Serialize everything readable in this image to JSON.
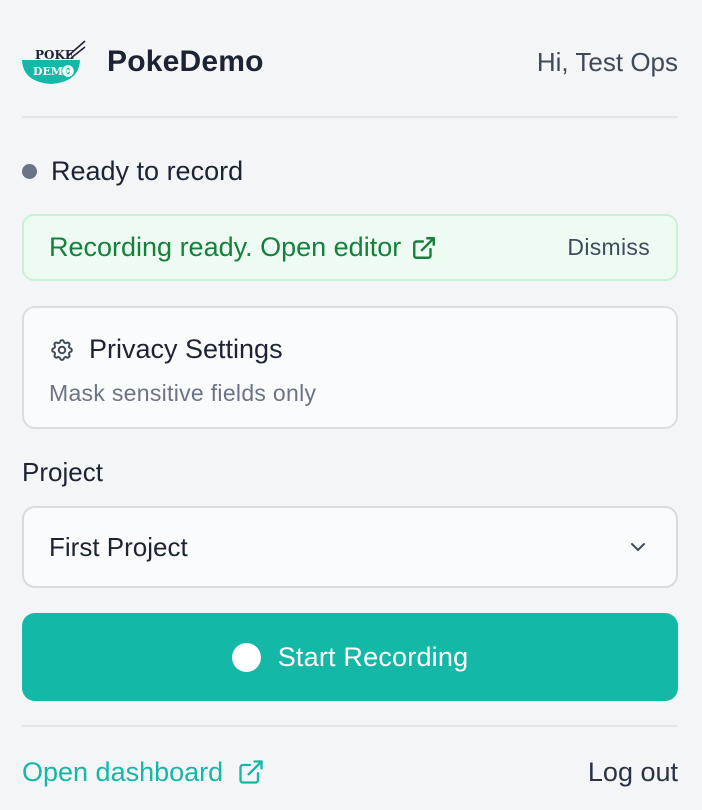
{
  "app": {
    "logo_text_top": "POKE",
    "logo_text_bottom": "DEMO",
    "brand": "PokeDemo",
    "greeting": "Hi, Test Ops"
  },
  "status": {
    "text": "Ready to record",
    "dot_color": "#6b7486"
  },
  "alert": {
    "message": "Recording ready. Open editor",
    "link_icon": "external-link-icon",
    "dismiss_label": "Dismiss",
    "text_color": "#15803d",
    "background": "#eefbf3"
  },
  "privacy": {
    "icon": "gear-icon",
    "title": "Privacy Settings",
    "subtitle": "Mask sensitive fields only"
  },
  "project": {
    "label": "Project",
    "selected": "First Project",
    "chevron_icon": "chevron-down-icon"
  },
  "record_button": {
    "label": "Start Recording",
    "color": "#14b8a6"
  },
  "footer": {
    "dashboard_link": "Open dashboard",
    "dashboard_icon": "external-link-icon",
    "logout": "Log out",
    "link_color": "#14b8a6"
  }
}
